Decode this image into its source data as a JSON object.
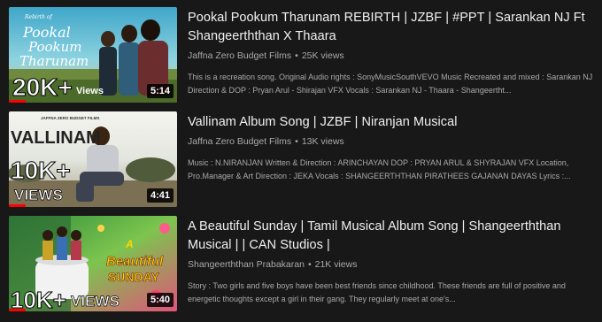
{
  "colors": {
    "background": "#181818",
    "progress": "#ff0000",
    "meta": "#aaaaaa"
  },
  "videos": [
    {
      "title": "Pookal Pookum Tharunam REBIRTH | JZBF | #PPT | Sarankan NJ Ft Shangeerththan X Thaara",
      "channel": "Jaffna Zero Budget Films",
      "views": "25K views",
      "description": "This is a recreation song. Original Audio rights : SonyMusicSouthVEVO Music Recreated and mixed : Sarankan NJ Direction & DOP : Pryan Arul - Shirajan VFX Vocals : Sarankan NJ - Thaara - Shangeertht...",
      "duration": "5:14",
      "progress": 0.1,
      "thumb_text": {
        "badge": "Rebirth of",
        "line1": "Pookal",
        "line2": "Pookum",
        "line3": "Tharunam",
        "count": "20K+",
        "suffix": "Views"
      }
    },
    {
      "title": "Vallinam Album Song | JZBF | Niranjan Musical",
      "channel": "Jaffna Zero Budget Films",
      "views": "13K views",
      "description": "Music : N.NIRANJAN Written & Direction : ARINCHAYAN DOP : PRYAN ARUL & SHYRAJAN VFX Location, Pro.Manager & Art Direction : JEKA Vocals : SHANGEERTHTHAN PIRATHEES GAJANAN DAYAS Lyrics :...",
      "duration": "4:41",
      "progress": 0.1,
      "thumb_text": {
        "badge": "JAFFNA ZERO BUDGET FILMS",
        "line1": "VALLINAM",
        "count": "10K+",
        "suffix": "VIEWS"
      }
    },
    {
      "title": "A Beautiful Sunday | Tamil Musical Album Song | Shangeerththan Musical | | CAN Studios |",
      "channel": "Shangeerththan Prabakaran",
      "views": "21K views",
      "description": "Story : Two girls and five boys have been best friends since childhood. These friends are full of positive and energetic thoughts except a girl in their gang. They regularly meet at one's...",
      "duration": "5:40",
      "progress": 0.1,
      "thumb_text": {
        "line1": "A",
        "line2": "Beautiful",
        "line3": "SUNDAY",
        "count": "10K+",
        "suffix": "VIEWS"
      }
    }
  ]
}
